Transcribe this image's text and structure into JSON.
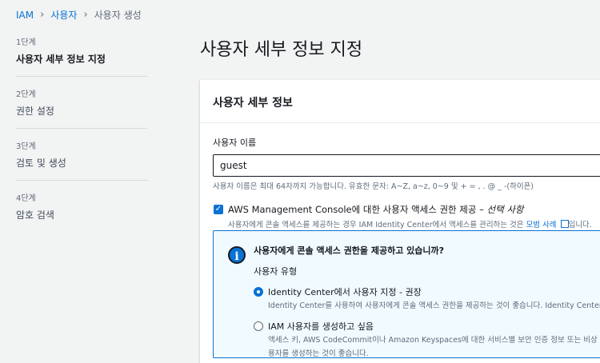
{
  "breadcrumb": {
    "items": [
      "IAM",
      "사용자",
      "사용자 생성"
    ]
  },
  "steps": [
    {
      "num": "1단계",
      "title": "사용자 세부 정보 지정"
    },
    {
      "num": "2단계",
      "title": "권한 설정"
    },
    {
      "num": "3단계",
      "title": "검토 및 생성"
    },
    {
      "num": "4단계",
      "title": "암호 검색"
    }
  ],
  "page": {
    "title": "사용자 세부 정보 지정"
  },
  "panel": {
    "title": "사용자 세부 정보",
    "username_label": "사용자 이름",
    "username_value": "guest",
    "username_hint": "사용자 이름은 최대 64자까지 가능합니다. 유효한 문자: A~Z, a~z, 0~9 및 + = , . @ _ -(하이픈)",
    "console_access": {
      "label": "AWS Management Console에 대한 사용자 액세스 권한 제공 – ",
      "optional": "선택 사항",
      "desc_prefix": "사용자에게 콘솔 액세스를 제공하는 경우 IAM Identity Center에서 액세스를 관리하는 것은 ",
      "desc_link": "모범 사례",
      "desc_suffix": "입니다."
    },
    "info": {
      "question": "사용자에게 콘솔 액세스 권한을 제공하고 있습니까?",
      "user_type_label": "사용자 유형",
      "option1_label": "Identity Center에서 사용자 지정 - 권장",
      "option1_desc": "Identity Center를 사용하여 사용자에게 콘솔 액세스 권한을 제공하는 것이 좋습니다. Identity Center를",
      "option2_label": "IAM 사용자를 생성하고 싶음",
      "option2_desc1": "액세스 키, AWS CodeCommit이나 Amazon Keyspaces에 대한 서비스별 보안 인증 정보 또는 비상 계정 액",
      "option2_desc2": "용자를 생성하는 것이 좋습니다."
    }
  },
  "colors": {
    "accent": "#0972d3",
    "background": "#f2f3f3",
    "info_bg": "#f1faff"
  }
}
